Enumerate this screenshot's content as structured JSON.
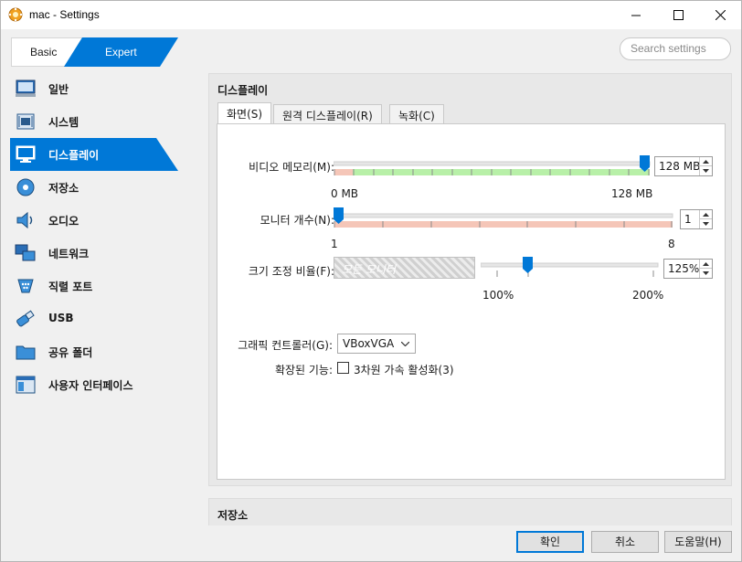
{
  "window": {
    "title": "mac - Settings",
    "minimize_icon": "minimize-icon",
    "maximize_icon": "maximize-icon",
    "close_icon": "close-icon"
  },
  "mode": {
    "basic_label": "Basic",
    "expert_label": "Expert",
    "selected": "Expert"
  },
  "search": {
    "placeholder": "Search settings"
  },
  "sidebar": {
    "items": [
      {
        "label": "일반",
        "icon": "general-icon"
      },
      {
        "label": "시스템",
        "icon": "system-chip-icon"
      },
      {
        "label": "디스플레이",
        "icon": "display-monitor-icon",
        "active": true
      },
      {
        "label": "저장소",
        "icon": "storage-disk-icon"
      },
      {
        "label": "오디오",
        "icon": "audio-speaker-icon"
      },
      {
        "label": "네트워크",
        "icon": "network-icon"
      },
      {
        "label": "직렬 포트",
        "icon": "serial-port-icon"
      },
      {
        "label": "USB",
        "icon": "usb-icon"
      },
      {
        "label": "공유 폴더",
        "icon": "shared-folder-icon"
      },
      {
        "label": "사용자 인터페이스",
        "icon": "user-interface-icon"
      }
    ]
  },
  "display": {
    "section_title": "디스플레이",
    "tabs": [
      "화면(S)",
      "원격 디스플레이(R)",
      "녹화(C)"
    ],
    "active_tab": "화면(S)",
    "video_memory": {
      "label": "비디오 메모리(M):",
      "value": "128 MB",
      "min_label": "0 MB",
      "max_label": "128 MB"
    },
    "monitor_count": {
      "label": "모니터 개수(N):",
      "value": "1",
      "min_label": "1",
      "max_label": "8"
    },
    "scale_factor": {
      "label": "크기 조정 비율(F):",
      "combo_text": "모든 모니터",
      "value": "125%",
      "min_label": "100%",
      "max_label": "200%"
    },
    "graphics_controller": {
      "label": "그래픽 컨트롤러(G):",
      "value": "VBoxVGA"
    },
    "extended_features": {
      "label": "확장된 기능:",
      "checkbox_label": "3차원 가속 활성화(3)",
      "checked": false
    }
  },
  "storage_section": {
    "title": "저장소"
  },
  "buttons": {
    "ok": "확인",
    "cancel": "취소",
    "help": "도움말(H)"
  },
  "colors": {
    "accent": "#0078d7",
    "slider_green": "#b8f0a8",
    "slider_red": "#f5c6b8"
  }
}
